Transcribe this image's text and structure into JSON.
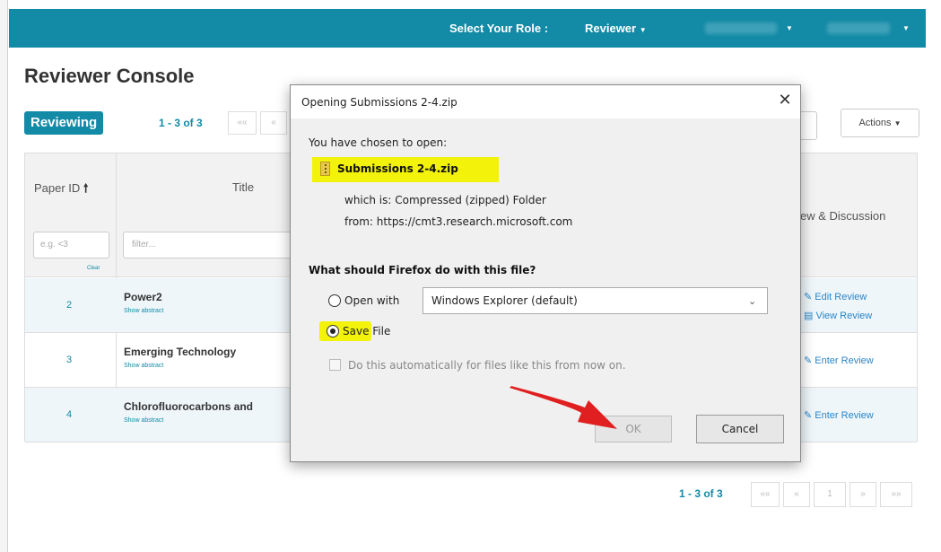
{
  "topbar": {
    "role_label": "Select Your Role :",
    "role_value": "Reviewer",
    "colors": {
      "bar": "#138aa6"
    }
  },
  "console": {
    "title": "Reviewer Console",
    "tab_label": "Reviewing",
    "pager_text": "1 - 3 of 3",
    "actions_label": "Actions"
  },
  "table": {
    "headers": {
      "paper_id": "Paper ID",
      "title": "Title",
      "review": "ew & Discussion"
    },
    "filter_id_placeholder": "e.g. <3",
    "filter_clear": "Clear",
    "filter_title_placeholder": "filter...",
    "rows": [
      {
        "id": "2",
        "title": "Power2",
        "abstract_link": "Show abstract",
        "link1": "Edit Review",
        "link2": "View Review"
      },
      {
        "id": "3",
        "title": "Emerging Technology",
        "abstract_link": "Show abstract",
        "link1": "Enter Review"
      },
      {
        "id": "4",
        "title": "Chlorofluorocarbons and",
        "abstract_link": "Show abstract",
        "link1": "Enter Review"
      }
    ]
  },
  "bottom_pager": {
    "text": "1 - 3 of 3",
    "current_page": "1"
  },
  "dialog": {
    "title": "Opening Submissions 2-4.zip",
    "chosen_label": "You have chosen to open:",
    "file_name": "Submissions 2-4.zip",
    "which_is_label": "which is:",
    "which_is_value": "Compressed (zipped) Folder",
    "from_label": "from:",
    "from_value": "https://cmt3.research.microsoft.com",
    "question": "What should Firefox do with this file?",
    "open_with_label": "Open with",
    "open_with_app": "Windows Explorer (default)",
    "save_file_label": "Save File",
    "selected_option": "save_file",
    "auto_label": "Do this automatically for files like this from now on.",
    "ok_label": "OK",
    "cancel_label": "Cancel",
    "highlight_color": "#f2f20a",
    "arrow_color": "#e02020"
  }
}
